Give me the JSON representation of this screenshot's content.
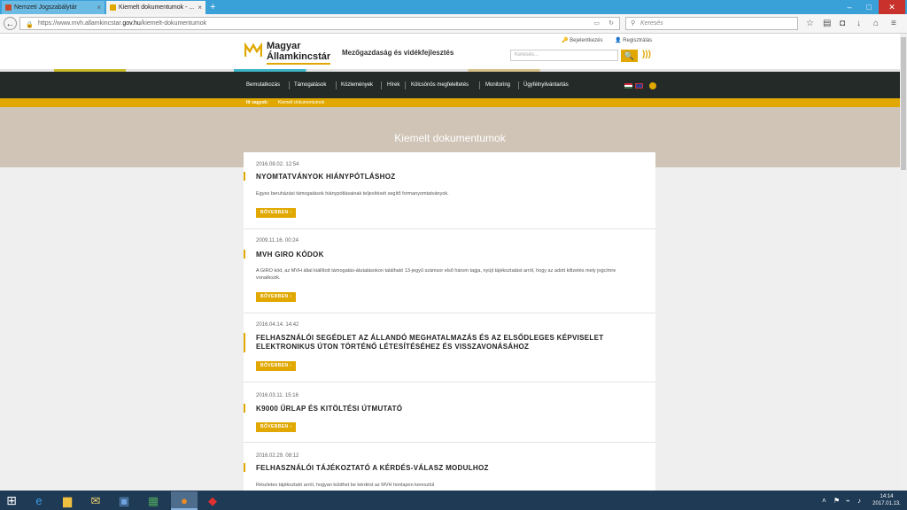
{
  "browser": {
    "tabs": [
      {
        "label": "Nemzeti Jogszabálytár",
        "close": "×"
      },
      {
        "label": "Kiemelt dokumentumok - ...",
        "close": "×"
      }
    ],
    "new_tab": "+",
    "window_controls": {
      "minimize": "–",
      "maximize": "□",
      "close": "✕"
    },
    "url_prefix": "https://www.mvh.allamkincstar.",
    "url_domain": "gov.hu",
    "url_path": "/kiemelt-dokumentumok",
    "search_placeholder": "Keresés",
    "icons": [
      "back-icon",
      "lock-icon",
      "reader-icon",
      "reload-icon",
      "search-icon",
      "star-icon",
      "clipboard-icon",
      "pocket-icon",
      "download-icon",
      "home-icon",
      "menu-icon"
    ]
  },
  "header": {
    "logo_line1": "Magyar",
    "logo_line2": "Államkincstár",
    "ministry": "Mezőgazdaság és vidékfejlesztés",
    "login_label": "Bejelentkezés",
    "register_label": "Regisztrálás",
    "search_placeholder": "Keresés...",
    "search_icon": "🔍",
    "rss_icon": "rss-icon"
  },
  "nav": {
    "items": [
      "Bemutatkozás",
      "Támogatások",
      "Közlemények",
      "Hírek",
      "Kölcsönös megfeleltetés",
      "Monitoring",
      "Ügyfélnyilvántartás"
    ],
    "languages": [
      "hu-flag",
      "en-flag"
    ]
  },
  "breadcrumb": {
    "here_label": "Itt vagyok:",
    "current": "Kiemelt dokumentumok"
  },
  "page": {
    "title": "Kiemelt dokumentumok",
    "more_label": "BŐVEBBEN ›",
    "entries": [
      {
        "date": "2016.08.02. 12:54",
        "title": "NYOMTATVÁNYOK HIÁNYPÓTLÁSHOZ",
        "desc": "Egyes beruházási támogatások hiánypótlásainak teljesítését segítő formanyomtatványok."
      },
      {
        "date": "2009.11.16. 00:24",
        "title": "MVH GIRO KÓDOK",
        "desc": "A GIRO kód, az MVH által kiállított támogatás-átutalásokon található 13-jegyű számsor első három tagja, nyújt tájékoztatást arról, hogy az adott kifizetés mely jogcímre vonatkozik."
      },
      {
        "date": "2016.04.14. 14:42",
        "title": "FELHASZNÁLÓI SEGÉDLET AZ ÁLLANDÓ MEGHATALMAZÁS ÉS AZ ELSŐDLEGES KÉPVISELET ELEKTRONIKUS ÚTON TÖRTÉNŐ LÉTESÍTÉSÉHEZ ÉS VISSZAVONÁSÁHOZ",
        "desc": ""
      },
      {
        "date": "2016.03.11. 15:16",
        "title": "K9000 ŰRLAP ÉS KITÖLTÉSI ÚTMUTATÓ",
        "desc": ""
      },
      {
        "date": "2016.02.29. 08:12",
        "title": "FELHASZNÁLÓI TÁJÉKOZTATÓ A KÉRDÉS-VÁLASZ MODULHOZ",
        "desc": "Részletes tájékoztató arról, hogyan küldhet be kérdést az MVH honlapon keresztül"
      }
    ]
  },
  "taskbar": {
    "apps": [
      "windows-start-icon",
      "edge-icon",
      "file-explorer-icon",
      "mail-icon",
      "word-icon",
      "excel-icon",
      "firefox-icon",
      "acrobat-icon"
    ],
    "time": "14:14",
    "date": "2017.01.13."
  }
}
